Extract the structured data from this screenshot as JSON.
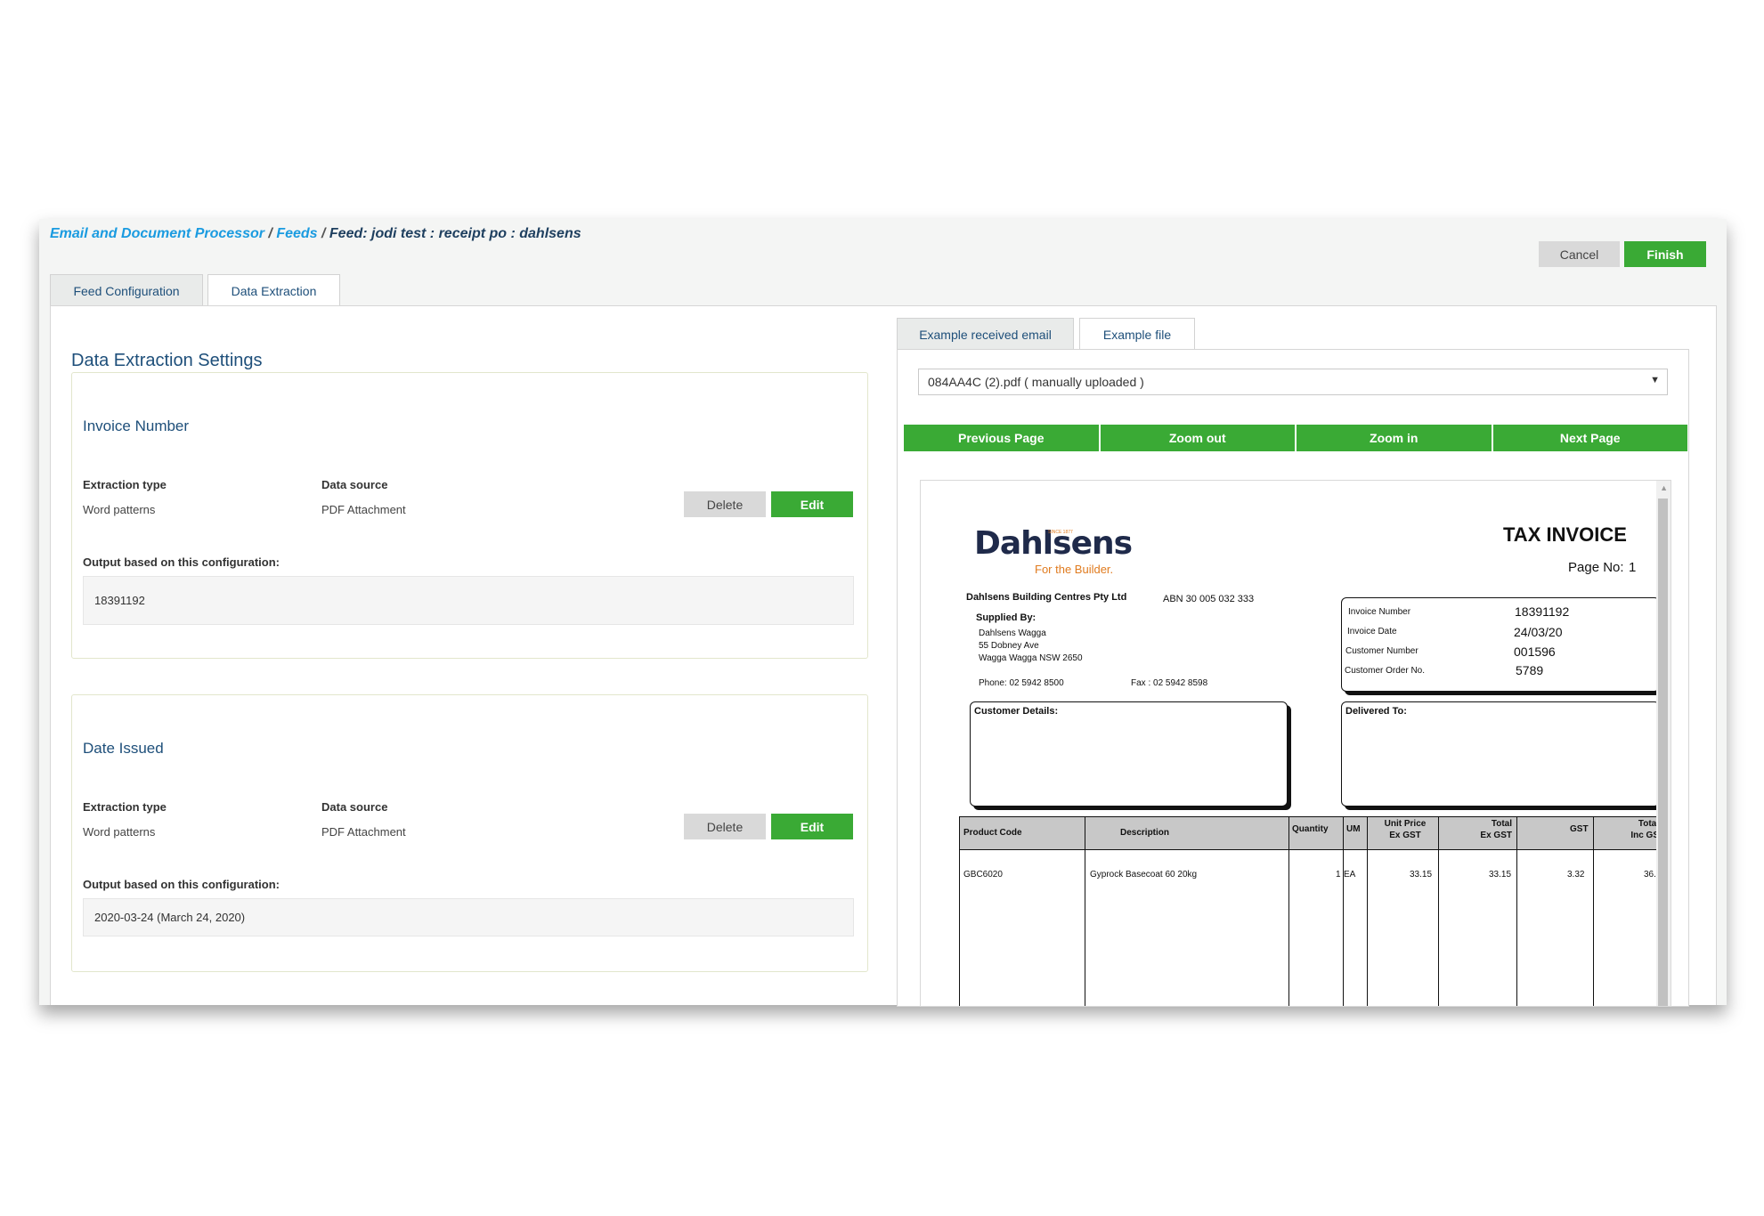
{
  "breadcrumb": {
    "item1": "Email and Document Processor",
    "sep1": " / ",
    "item2": "Feeds",
    "sep2": " / ",
    "current": "Feed: jodi test : receipt po : dahlsens"
  },
  "actions": {
    "cancel": "Cancel",
    "finish": "Finish"
  },
  "tabs": [
    "Feed Configuration",
    "Data Extraction"
  ],
  "section_title": "Data Extraction Settings",
  "cards": [
    {
      "title": "Invoice Number",
      "extraction_type_label": "Extraction type",
      "extraction_type": "Word patterns",
      "data_source_label": "Data source",
      "data_source": "PDF Attachment",
      "delete": "Delete",
      "edit": "Edit",
      "output_label": "Output based on this configuration:",
      "output": "18391192"
    },
    {
      "title": "Date Issued",
      "extraction_type_label": "Extraction type",
      "extraction_type": "Word patterns",
      "data_source_label": "Data source",
      "data_source": "PDF Attachment",
      "delete": "Delete",
      "edit": "Edit",
      "output_label": "Output based on this configuration:",
      "output": "2020-03-24 (March 24, 2020)"
    }
  ],
  "right_tabs": [
    "Example received email",
    "Example file"
  ],
  "file_select": {
    "value": "084AA4C (2).pdf ( manually uploaded )",
    "arrow": "▼"
  },
  "viewer_nav": [
    "Previous Page",
    "Zoom out",
    "Zoom in",
    "Next Page"
  ],
  "invoice": {
    "logo": "Dahlsens",
    "logo_since": "SINCE 1877",
    "tagline": "For the Builder.",
    "title": "TAX INVOICE",
    "page_label": "Page No:",
    "page_no": "1",
    "company": "Dahlsens Building Centres Pty Ltd",
    "abn": "ABN 30 005 032 333",
    "supplied_by_label": "Supplied By:",
    "supplier_lines": [
      "Dahlsens Wagga",
      "55 Dobney Ave",
      "Wagga Wagga NSW 2650"
    ],
    "phone": "Phone:  02 5942 8500",
    "fax": "Fax  :  02 5942 8598",
    "meta": [
      {
        "label": "Invoice Number",
        "value": "18391192"
      },
      {
        "label": "Invoice Date",
        "value": "24/03/20"
      },
      {
        "label": "Customer Number",
        "value": "001596"
      },
      {
        "label": "Customer Order No.",
        "value": "5789"
      }
    ],
    "customer_details_label": "Customer Details:",
    "delivered_to_label": "Delivered To:",
    "table_headers": [
      "Product Code",
      "Description",
      "Quantity",
      "UM",
      "Unit Price Ex GST",
      "Total Ex GST",
      "GST",
      "Total Inc GST"
    ],
    "table_header_lines": {
      "unit_price_1": "Unit Price",
      "unit_price_2": "Ex GST",
      "total_ex_1": "Total",
      "total_ex_2": "Ex GST",
      "total_inc_1": "Total",
      "total_inc_2": "Inc GS"
    },
    "row": {
      "product_code": "GBC6020",
      "description": "Gyprock Basecoat 60 20kg",
      "quantity": "1",
      "um": "EA",
      "unit_price": "33.15",
      "total_ex": "33.15",
      "gst": "3.32",
      "total_inc": "36."
    }
  }
}
